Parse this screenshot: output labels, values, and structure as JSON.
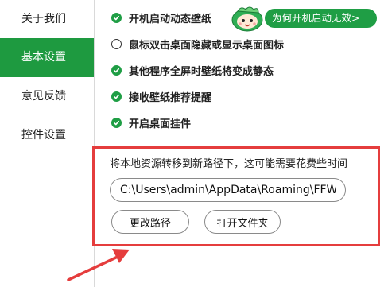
{
  "sidebar": {
    "items": [
      {
        "label": "关于我们",
        "active": false
      },
      {
        "label": "基本设置",
        "active": true
      },
      {
        "label": "意见反馈",
        "active": false
      },
      {
        "label": "控件设置",
        "active": false
      }
    ]
  },
  "options": [
    {
      "label": "开机启动动态壁纸",
      "checked": true
    },
    {
      "label": "鼠标双击桌面隐藏或显示桌面图标",
      "checked": false
    },
    {
      "label": "其他程序全屏时壁纸将变成静态",
      "checked": true
    },
    {
      "label": "接收壁纸推荐提醒",
      "checked": true
    },
    {
      "label": "开启桌面挂件",
      "checked": true
    }
  ],
  "promo": {
    "label": "为何开机启动无效>",
    "icon": "green-mascot-icon"
  },
  "storage": {
    "move_label": "将本地资源转移到新路径下，这可能需要花费些时间",
    "path_value": "C:\\Users\\admin\\AppData\\Roaming\\FFWallpaper",
    "change_path_label": "更改路径",
    "open_folder_label": "打开文件夹"
  },
  "colors": {
    "accent": "#1e9a40",
    "annotation": "#e53d3d"
  }
}
